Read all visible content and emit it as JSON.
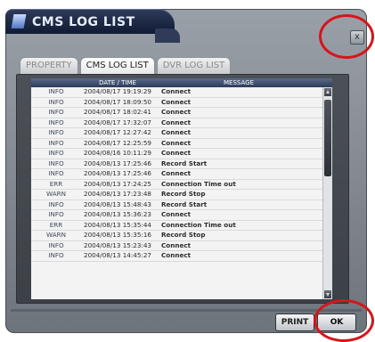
{
  "window": {
    "title": "CMS LOG LIST"
  },
  "tabs": [
    {
      "label": "PROPERTY"
    },
    {
      "label": "CMS LOG LIST"
    },
    {
      "label": "DVR LOG LIST"
    }
  ],
  "table": {
    "headers": {
      "type": "",
      "date_time": "DATE / TIME",
      "message": "MESSAGE"
    },
    "rows": [
      {
        "type": "INFO",
        "date": "2004/08/17 19:19:29",
        "message": "Connect"
      },
      {
        "type": "INFO",
        "date": "2004/08/17 18:09:50",
        "message": "Connect"
      },
      {
        "type": "INFO",
        "date": "2004/08/17 18:02:41",
        "message": "Connect"
      },
      {
        "type": "INFO",
        "date": "2004/08/17 17:32:07",
        "message": "Connect"
      },
      {
        "type": "INFO",
        "date": "2004/08/17 12:27:42",
        "message": "Connect"
      },
      {
        "type": "INFO",
        "date": "2004/08/17 12:25:59",
        "message": "Connect"
      },
      {
        "type": "INFO",
        "date": "2004/08/16 10:11:29",
        "message": "Connect"
      },
      {
        "type": "INFO",
        "date": "2004/08/13 17:25:46",
        "message": "Record Start"
      },
      {
        "type": "INFO",
        "date": "2004/08/13 17:25:46",
        "message": "Connect"
      },
      {
        "type": "ERR",
        "date": "2004/08/13 17:24:25",
        "message": "Connection Time out"
      },
      {
        "type": "WARN",
        "date": "2004/08/13 17:23:48",
        "message": "Record Stop"
      },
      {
        "type": "INFO",
        "date": "2004/08/13 15:48:43",
        "message": "Record Start"
      },
      {
        "type": "INFO",
        "date": "2004/08/13 15:36:23",
        "message": "Connect"
      },
      {
        "type": "ERR",
        "date": "2004/08/13 15:35:44",
        "message": "Connection Time out"
      },
      {
        "type": "WARN",
        "date": "2004/08/13 15:35:16",
        "message": "Record Stop"
      },
      {
        "type": "INFO",
        "date": "2004/08/13 15:23:43",
        "message": "Connect"
      },
      {
        "type": "INFO",
        "date": "2004/08/13 14:45:27",
        "message": "Connect"
      }
    ]
  },
  "buttons": {
    "print": "PRINT",
    "ok": "OK",
    "close": "x"
  },
  "icons": {
    "close": "close-icon",
    "title_logo": "window-logo-icon",
    "scroll_up": "scroll-up-icon",
    "scroll_down": "scroll-down-icon"
  },
  "colors": {
    "accent": "#2d3b5b",
    "annotation": "#d8141b"
  }
}
